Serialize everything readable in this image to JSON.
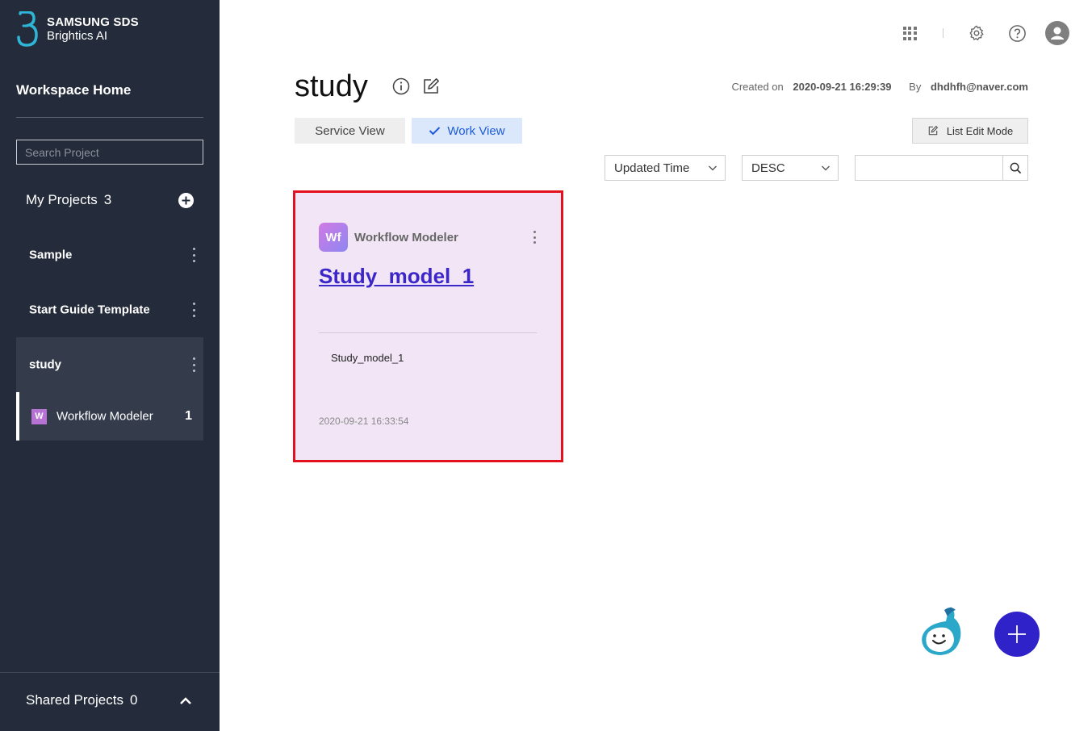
{
  "brand": {
    "line1": "SAMSUNG SDS",
    "line2": "Brightics AI"
  },
  "sidebar": {
    "home_label": "Workspace Home",
    "search_placeholder": "Search Project",
    "my_projects": {
      "label": "My Projects",
      "count": "3"
    },
    "projects": [
      {
        "label": "Sample"
      },
      {
        "label": "Start Guide Template"
      },
      {
        "label": "study",
        "active": true
      }
    ],
    "sub_item": {
      "badge": "W",
      "label": "Workflow Modeler",
      "count": "1"
    },
    "shared_projects": {
      "label": "Shared Projects",
      "count": "0"
    }
  },
  "header": {
    "title": "study",
    "created_label": "Created on",
    "created_value": "2020-09-21 16:29:39",
    "by_label": "By",
    "by_value": "dhdhfh@naver.com"
  },
  "tabs": [
    {
      "label": "Service View",
      "selected": false
    },
    {
      "label": "Work View",
      "selected": true
    }
  ],
  "list_edit_label": "List Edit Mode",
  "filters": {
    "sort_field": "Updated Time",
    "sort_order": "DESC",
    "search_value": ""
  },
  "cards": [
    {
      "badge": "Wf",
      "type": "Workflow Modeler",
      "title": "Study_model_1",
      "description": "Study_model_1",
      "date": "2020-09-21 16:33:54"
    }
  ],
  "colors": {
    "sidebar_bg": "#242b3a",
    "accent": "#2f22c9",
    "card_bg": "#f2e6f6",
    "highlight": "#e3111d",
    "work_tab_bg": "#dbe8fc"
  },
  "icons": [
    "apps-grid-icon",
    "settings-icon",
    "help-icon",
    "user-icon",
    "info-icon",
    "edit-icon",
    "check-icon",
    "chevron-down-icon",
    "search-icon",
    "plus-icon",
    "kebab-icon",
    "chevron-up-icon"
  ]
}
